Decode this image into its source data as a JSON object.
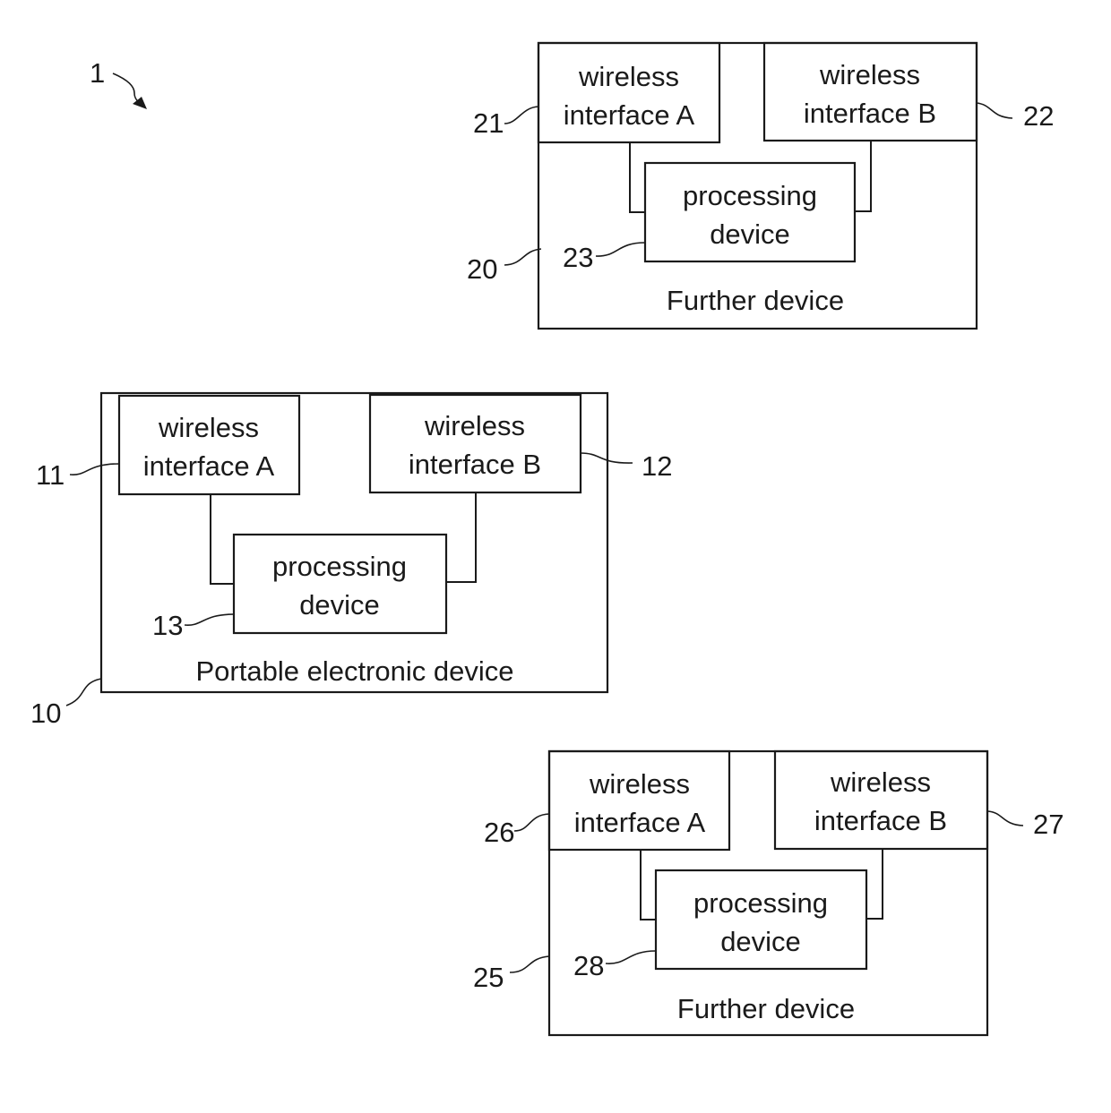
{
  "diagram": {
    "system_ref": "1",
    "devices": [
      {
        "id": "further-device-top",
        "ref": "20",
        "label": "Further device",
        "interface_a": {
          "ref": "21",
          "line1": "wireless",
          "line2": "interface A"
        },
        "interface_b": {
          "ref": "22",
          "line1": "wireless",
          "line2": "interface B"
        },
        "processor": {
          "ref": "23",
          "line1": "processing",
          "line2": "device"
        }
      },
      {
        "id": "portable-electronic-device",
        "ref": "10",
        "label": "Portable electronic device",
        "interface_a": {
          "ref": "11",
          "line1": "wireless",
          "line2": "interface A"
        },
        "interface_b": {
          "ref": "12",
          "line1": "wireless",
          "line2": "interface B"
        },
        "processor": {
          "ref": "13",
          "line1": "processing",
          "line2": "device"
        }
      },
      {
        "id": "further-device-bottom",
        "ref": "25",
        "label": "Further device",
        "interface_a": {
          "ref": "26",
          "line1": "wireless",
          "line2": "interface A"
        },
        "interface_b": {
          "ref": "27",
          "line1": "wireless",
          "line2": "interface B"
        },
        "processor": {
          "ref": "28",
          "line1": "processing",
          "line2": "device"
        }
      }
    ]
  }
}
